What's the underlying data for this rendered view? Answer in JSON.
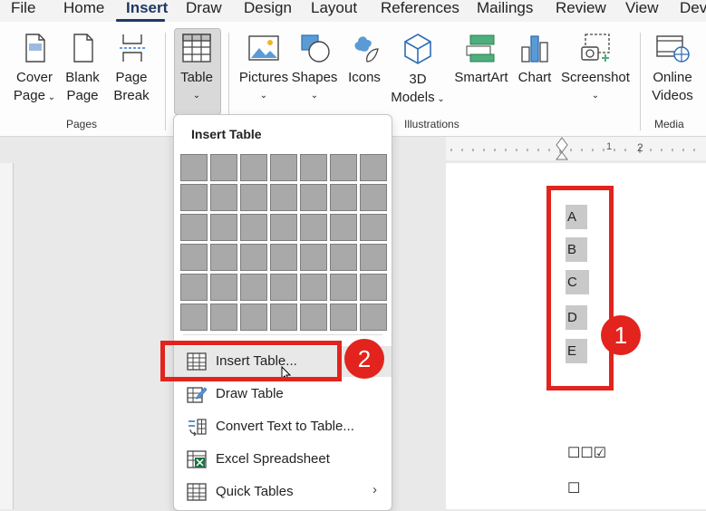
{
  "menu": {
    "items": [
      "File",
      "Home",
      "Insert",
      "Draw",
      "Design",
      "Layout",
      "References",
      "Mailings",
      "Review",
      "View",
      "Dev"
    ],
    "active": "Insert"
  },
  "ribbon": {
    "pages": {
      "cover_page": [
        "Cover",
        "Page"
      ],
      "blank_page": [
        "Blank",
        "Page"
      ],
      "page_break": [
        "Page",
        "Break"
      ],
      "group_label": "Pages"
    },
    "table": {
      "label": "Table"
    },
    "illustrations": {
      "pictures": "Pictures",
      "shapes": "Shapes",
      "icons": "Icons",
      "models": [
        "3D",
        "Models"
      ],
      "smartart": "SmartArt",
      "chart": "Chart",
      "screenshot": "Screenshot",
      "group_label": "Illustrations"
    },
    "media": {
      "online_videos": [
        "Online",
        "Videos"
      ],
      "group_label": "Media"
    }
  },
  "ruler": {
    "marks": [
      "1",
      "2"
    ]
  },
  "dropdown": {
    "title": "Insert Table",
    "grid": {
      "rows": 6,
      "cols": 7
    },
    "items": [
      {
        "label": "Insert Table...",
        "icon": "table-grid-icon"
      },
      {
        "label": "Draw Table",
        "icon": "pencil-table-icon"
      },
      {
        "label": "Convert Text to Table...",
        "icon": "convert-table-icon"
      },
      {
        "label": "Excel Spreadsheet",
        "icon": "excel-icon"
      },
      {
        "label": "Quick Tables",
        "icon": "table-grid-icon"
      }
    ]
  },
  "document": {
    "letters": [
      "A",
      "B",
      "C",
      "D",
      "E"
    ],
    "checkboxes_line1": "☐☐☑",
    "checkboxes_line2": "☐"
  },
  "annotations": {
    "badge1": "1",
    "badge2": "2",
    "color": "#e3231d"
  }
}
